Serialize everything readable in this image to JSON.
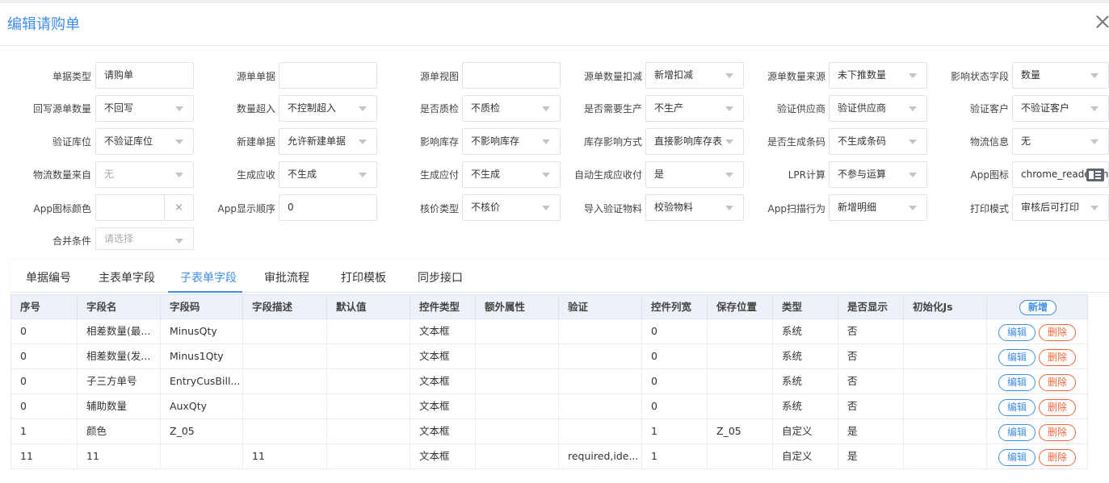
{
  "dialog": {
    "title": "编辑请购单"
  },
  "form": {
    "f_doc_type": {
      "label": "单据类型",
      "value": "请购单"
    },
    "f_src_doc": {
      "label": "源单单据",
      "value": ""
    },
    "f_src_view": {
      "label": "源单视图",
      "value": ""
    },
    "f_src_qty_deduct": {
      "label": "源单数量扣减",
      "value": "新增扣减"
    },
    "f_src_qty_source": {
      "label": "源单数量来源",
      "value": "未下推数量"
    },
    "f_status_field": {
      "label": "影响状态字段",
      "value": "数量"
    },
    "f_writeback_qty": {
      "label": "回写源单数量",
      "value": "不回写"
    },
    "f_qty_exceed": {
      "label": "数量超入",
      "value": "不控制超入"
    },
    "f_qc": {
      "label": "是否质检",
      "value": "不质检"
    },
    "f_need_prod": {
      "label": "是否需要生产",
      "value": "不生产"
    },
    "f_verify_supplier": {
      "label": "验证供应商",
      "value": "验证供应商"
    },
    "f_verify_customer": {
      "label": "验证客户",
      "value": "不验证客户"
    },
    "f_verify_loc": {
      "label": "验证库位",
      "value": "不验证库位"
    },
    "f_new_doc": {
      "label": "新建单据",
      "value": "允许新建单据"
    },
    "f_affect_stock": {
      "label": "影响库存",
      "value": "不影响库存"
    },
    "f_stock_mode": {
      "label": "库存影响方式",
      "value": "直接影响库存表"
    },
    "f_gen_barcode": {
      "label": "是否生成条码",
      "value": "不生成条码"
    },
    "f_logistics": {
      "label": "物流信息",
      "value": "无"
    },
    "f_logistics_src": {
      "label": "物流数量来自",
      "value": "无"
    },
    "f_gen_recv": {
      "label": "生成应收",
      "value": "不生成"
    },
    "f_gen_pay": {
      "label": "生成应付",
      "value": "不生成"
    },
    "f_auto_recv": {
      "label": "自动生成应收付",
      "value": "是"
    },
    "f_lpr": {
      "label": "LPR计算",
      "value": "不参与运算"
    },
    "f_app_icon": {
      "label": "App图标",
      "value": "chrome_reader_mode"
    },
    "f_app_icon_color": {
      "label": "App图标颜色",
      "value": "",
      "clear": "×"
    },
    "f_app_order": {
      "label": "App显示顺序",
      "value": "0"
    },
    "f_price_type": {
      "label": "核价类型",
      "value": "不核价"
    },
    "f_import_verify": {
      "label": "导入验证物料",
      "value": "校验物料"
    },
    "f_app_scan": {
      "label": "App扫描行为",
      "value": "新增明细"
    },
    "f_print_mode": {
      "label": "打印模式",
      "value": "审核后可打印"
    },
    "f_merge_cond": {
      "label": "合并条件",
      "placeholder": "请选择"
    }
  },
  "tabs": [
    "单据编号",
    "主表单字段",
    "子表单字段",
    "审批流程",
    "打印模板",
    "同步接口"
  ],
  "active_tab": "子表单字段",
  "table": {
    "headers": [
      "序号",
      "字段名",
      "字段码",
      "字段描述",
      "默认值",
      "控件类型",
      "额外属性",
      "验证",
      "控件列宽",
      "保存位置",
      "类型",
      "是否显示",
      "初始化Js"
    ],
    "add_label": "新增",
    "edit_label": "编辑",
    "delete_label": "删除",
    "rows": [
      [
        "0",
        "相差数量(最...",
        "MinusQty",
        "",
        "",
        "文本框",
        "",
        "",
        "0",
        "",
        "系统",
        "否",
        ""
      ],
      [
        "0",
        "相差数量(发...",
        "Minus1Qty",
        "",
        "",
        "文本框",
        "",
        "",
        "0",
        "",
        "系统",
        "否",
        ""
      ],
      [
        "0",
        "子三方单号",
        "EntryCusBill...",
        "",
        "",
        "文本框",
        "",
        "",
        "0",
        "",
        "系统",
        "否",
        ""
      ],
      [
        "0",
        "辅助数量",
        "AuxQty",
        "",
        "",
        "文本框",
        "",
        "",
        "0",
        "",
        "系统",
        "否",
        ""
      ],
      [
        "1",
        "颜色",
        "Z_05",
        "",
        "",
        "文本框",
        "",
        "",
        "1",
        "Z_05",
        "自定义",
        "是",
        ""
      ],
      [
        "11",
        "11",
        "",
        "11",
        "",
        "文本框",
        "",
        "required,ide...",
        "1",
        "",
        "自定义",
        "是",
        ""
      ]
    ]
  }
}
